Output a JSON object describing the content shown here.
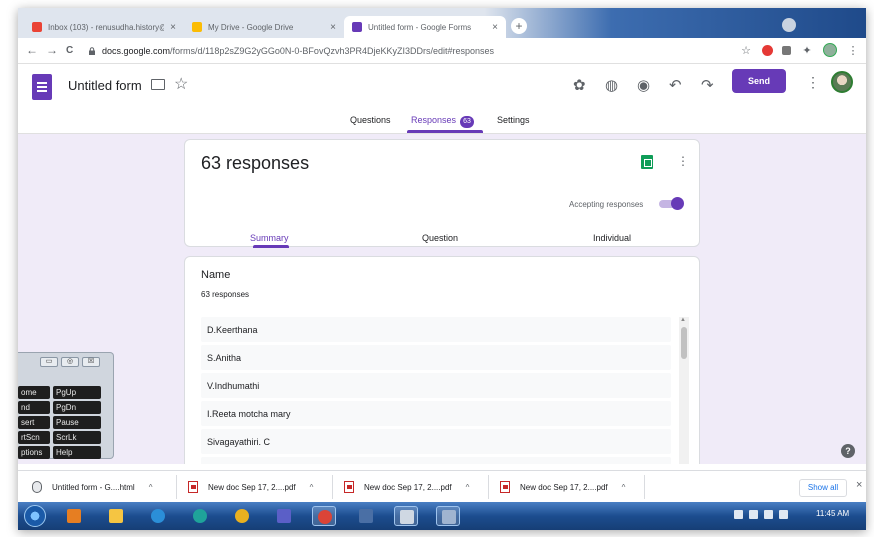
{
  "browser": {
    "tabs": [
      {
        "title": "Inbox (103) - renusudha.history@...",
        "favicon_color": "#ea4335",
        "active": false
      },
      {
        "title": "My Drive - Google Drive",
        "favicon_color": "#fbbc04",
        "active": false
      },
      {
        "title": "Untitled form - Google Forms",
        "favicon_color": "#673ab7",
        "active": true
      }
    ],
    "tab_close_glyph": "×",
    "new_tab_glyph": "+",
    "back_glyph": "←",
    "forward_glyph": "→",
    "reload_glyph": "C",
    "url_host": "docs.google.com",
    "url_path": "/forms/d/118p2sZ9G2yGGo0N-0-BFovQzvh3PR4DjeKKyZI3DDrs/edit#responses",
    "bookmark_glyph": "☆",
    "puzzle_glyph": "✦",
    "menu_glyph": "⋮"
  },
  "form": {
    "title": "Untitled form",
    "star_glyph": "☆",
    "toolbar_glyphs": {
      "addon": "✿",
      "palette": "◍",
      "preview": "◉",
      "undo": "↶",
      "redo": "↷"
    },
    "send_label": "Send",
    "kebab_glyph": "⋮",
    "tabs": {
      "questions": "Questions",
      "responses": "Responses",
      "settings": "Settings"
    },
    "responses_badge": "63",
    "accent_color": "#673ab7"
  },
  "summary": {
    "title": "63 responses",
    "kebab_glyph": "⋮",
    "accepting_label": "Accepting responses",
    "accepting": true,
    "subtabs": {
      "summary": "Summary",
      "question": "Question",
      "individual": "Individual"
    }
  },
  "question": {
    "title": "Name",
    "count": "63 responses",
    "responses": [
      "D.Keerthana",
      "S.Anitha",
      "V.Indhumathi",
      "I.Reeta motcha mary",
      "Sivagayathiri. C"
    ],
    "scroll_up_glyph": "▲"
  },
  "help_glyph": "?",
  "osk": {
    "window_buttons": [
      "▭",
      "◎",
      "☒"
    ],
    "keys": [
      [
        "ome",
        "PgUp"
      ],
      [
        "nd",
        "PgDn"
      ],
      [
        "sert",
        "Pause"
      ],
      [
        "rtScn",
        "ScrLk"
      ],
      [
        "ptions",
        "Help"
      ]
    ]
  },
  "downloads": {
    "items": [
      {
        "name": "Untitled form - G....html",
        "type": "html"
      },
      {
        "name": "New doc Sep 17, 2....pdf",
        "type": "pdf"
      },
      {
        "name": "New doc Sep 17, 2....pdf",
        "type": "pdf"
      },
      {
        "name": "New doc Sep 17, 2....pdf",
        "type": "pdf"
      }
    ],
    "chevron_glyph": "^",
    "show_all": "Show all",
    "close_glyph": "×"
  },
  "taskbar": {
    "apps": [
      {
        "name": "media-player",
        "color": "#e67e22"
      },
      {
        "name": "file-explorer",
        "color": "#f5c542"
      },
      {
        "name": "internet-explorer",
        "color": "#2b8fd8"
      },
      {
        "name": "edge",
        "color": "#1fa39a"
      },
      {
        "name": "chrome-canary",
        "color": "#e8b020"
      },
      {
        "name": "teams",
        "color": "#5b5fc7"
      },
      {
        "name": "chrome",
        "color": "#db4437"
      },
      {
        "name": "app-window",
        "color": "#4a6fa5"
      },
      {
        "name": "snipping-tool",
        "color": "#cfd8e3"
      },
      {
        "name": "screen-capture",
        "color": "#a0b4d0"
      }
    ],
    "clock": "11:45 AM"
  }
}
